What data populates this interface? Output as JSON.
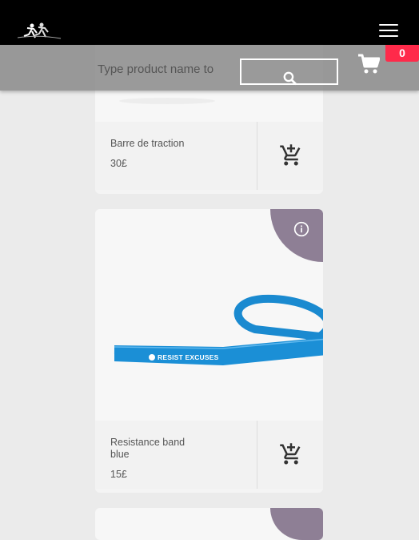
{
  "header": {
    "logo_icon": "runners-logo",
    "menu_icon": "hamburger-icon"
  },
  "search": {
    "placeholder": "Type product name to",
    "button_icon": "search-icon"
  },
  "cart": {
    "icon": "shopping-cart-icon",
    "count": "0"
  },
  "products": [
    {
      "name": "Barre de traction",
      "price": "30£",
      "add_icon": "add-to-cart-icon"
    },
    {
      "name": "Resistance band blue",
      "price": "15£",
      "add_icon": "add-to-cart-icon",
      "info_icon": "info-icon",
      "band_text": "RESIST EXCUSES"
    }
  ],
  "colors": {
    "topbar": "#000000",
    "searchbar": "#808080",
    "badge": "#ff2a4a",
    "info_corner": "#8e7f95",
    "band": "#1b8fd6"
  }
}
